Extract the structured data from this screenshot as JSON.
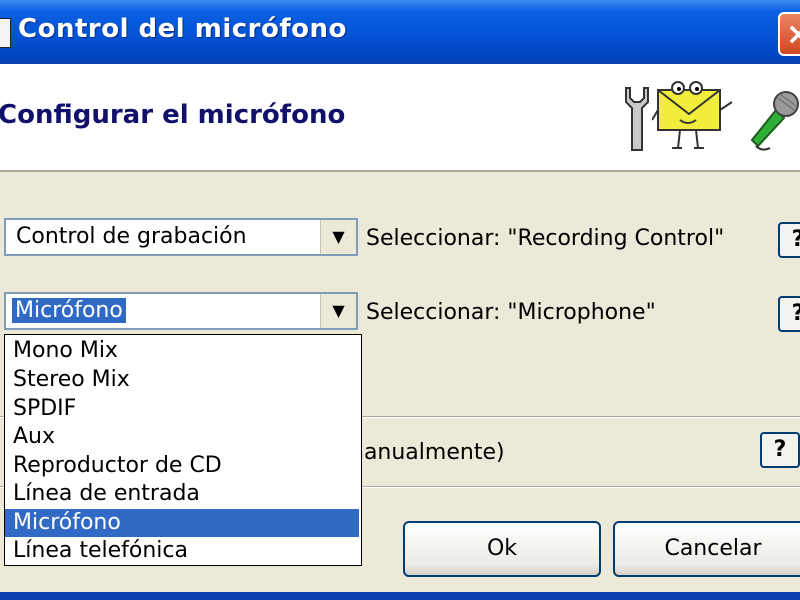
{
  "window": {
    "title": "Control del micrófono",
    "close_label": "×"
  },
  "header": {
    "title": "Configurar el micrófono"
  },
  "row1": {
    "combo_value": "Control de grabación",
    "hint": "Seleccionar: \"Recording Control\"",
    "help_label": "?"
  },
  "row2": {
    "combo_value": "Micrófono",
    "hint": "Seleccionar: \"Microphone\"",
    "help_label": "?",
    "options": [
      "Mono Mix",
      "Stereo Mix",
      "SPDIF",
      "Aux",
      "Reproductor de CD",
      "Línea de entrada",
      "Micrófono",
      "Línea telefónica"
    ],
    "highlighted_option": "Micrófono"
  },
  "row3": {
    "partial_text": "nanualmente)",
    "help_label": "?"
  },
  "buttons": {
    "ok": "Ok",
    "cancel": "Cancelar"
  },
  "icons": [
    "wrench-icon",
    "mascot-envelope-icon",
    "microphone-icon",
    "app-icon"
  ],
  "colors": {
    "title_bar": "#0453d8",
    "selection": "#316ac5",
    "header_text": "#11116b"
  }
}
